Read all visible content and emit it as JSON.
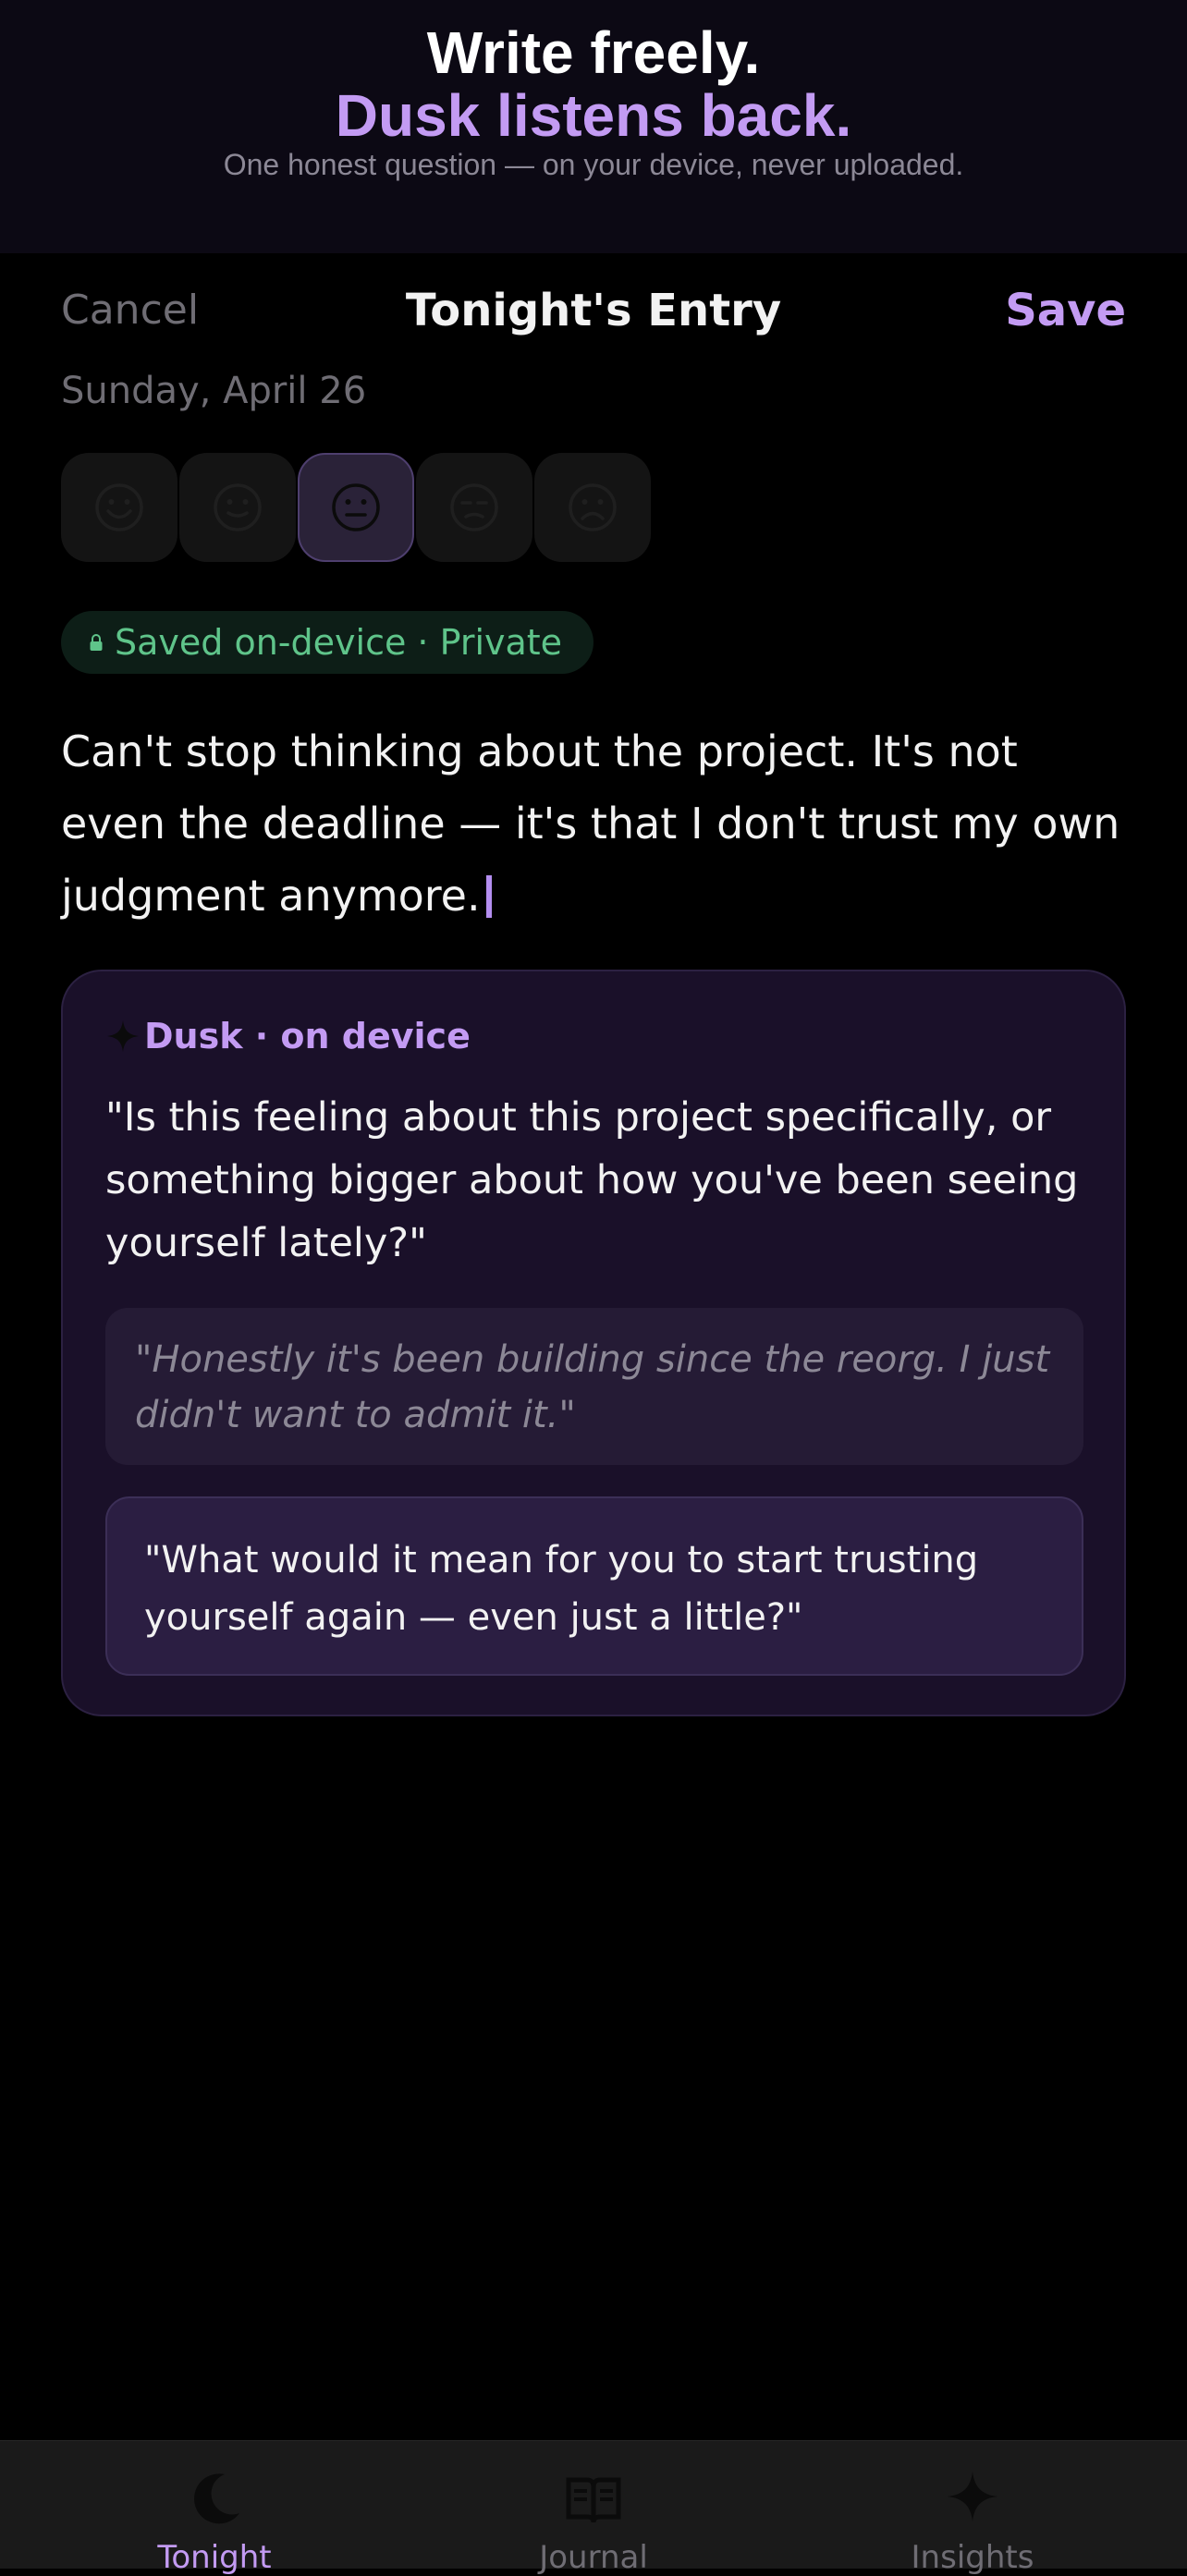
{
  "hero": {
    "title": "Write freely.",
    "accent": "Dusk listens back.",
    "subtitle": "One honest question — on your device, never uploaded."
  },
  "nav": {
    "cancel_label": "Cancel",
    "title": "Tonight's Entry",
    "save_label": "Save"
  },
  "entry": {
    "date": "Sunday, April 26",
    "moods": [
      {
        "icon": "smiling-face-icon",
        "selected": false
      },
      {
        "icon": "slightly-smiling-face-icon",
        "selected": false
      },
      {
        "icon": "neutral-face-icon",
        "selected": true
      },
      {
        "icon": "pensive-face-icon",
        "selected": false
      },
      {
        "icon": "frowning-face-icon",
        "selected": false
      }
    ],
    "privacy_badge": "Saved on-device · Private",
    "text": "Can't stop thinking about the project. It's not even the deadline — it's that I don't trust my own judgment anymore."
  },
  "dusk": {
    "label": "Dusk · on device",
    "question": "\"Is this feeling about this project specifically, or something bigger about how you've been seeing yourself lately?\"",
    "user_reply": "\"Honestly it's been building since the reorg. I just didn't want to admit it.\"",
    "followup": "\"What would it mean for you to start trusting yourself again — even just a little?\""
  },
  "tabs": [
    {
      "label": "Tonight",
      "icon": "moon-icon",
      "active": true
    },
    {
      "label": "Journal",
      "icon": "book-icon",
      "active": false
    },
    {
      "label": "Insights",
      "icon": "sparkle-icon",
      "active": false
    }
  ],
  "colors": {
    "accent": "#c39bf3",
    "background": "#000000",
    "card": "#1a1029",
    "private_green": "#5fc48a",
    "muted": "#6f6d74"
  }
}
